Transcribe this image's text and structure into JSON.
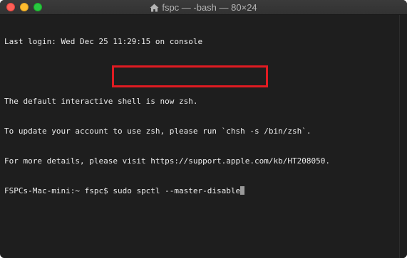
{
  "window": {
    "title": "fspc — -bash — 80×24",
    "title_icon": "home-icon",
    "colors": {
      "close": "#fe5f57",
      "minimize": "#febc2e",
      "zoom": "#28c840",
      "background": "#1e1e1e",
      "text": "#ececec",
      "highlight": "#e11b22"
    }
  },
  "terminal": {
    "lines": [
      "Last login: Wed Dec 25 11:29:15 on console",
      "",
      "The default interactive shell is now zsh.",
      "To update your account to use zsh, please run `chsh -s /bin/zsh`.",
      "For more details, please visit https://support.apple.com/kb/HT208050."
    ],
    "prompt": "FSPCs-Mac-mini:~ fspc$ ",
    "command": "sudo spctl --master-disable"
  }
}
